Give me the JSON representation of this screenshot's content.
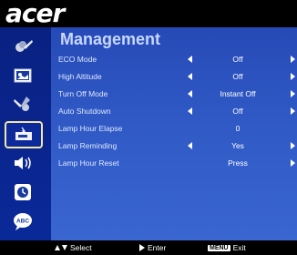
{
  "brand": "acer",
  "menu": {
    "title": "Management",
    "rows": [
      {
        "label": "ECO Mode",
        "value": "Off",
        "arrows": true
      },
      {
        "label": "High Altitude",
        "value": "Off",
        "arrows": true
      },
      {
        "label": "Turn Off Mode",
        "value": "Instant Off",
        "arrows": true
      },
      {
        "label": "Auto Shutdown",
        "value": "Off",
        "arrows": true
      },
      {
        "label": "Lamp Hour Elapse",
        "value": "0",
        "arrows": false
      },
      {
        "label": "Lamp Reminding",
        "value": "Yes",
        "arrows": true
      },
      {
        "label": "Lamp Hour Reset",
        "value": "Press",
        "arrows": true
      }
    ]
  },
  "sidebar": {
    "icons": [
      "color-icon",
      "image-icon",
      "settings-icon",
      "management-icon",
      "audio-icon",
      "timer-icon",
      "language-icon"
    ],
    "selected": "management-icon"
  },
  "footer": {
    "select": "Select",
    "enter": "Enter",
    "menu_key": "MENU",
    "exit": "Exit"
  }
}
